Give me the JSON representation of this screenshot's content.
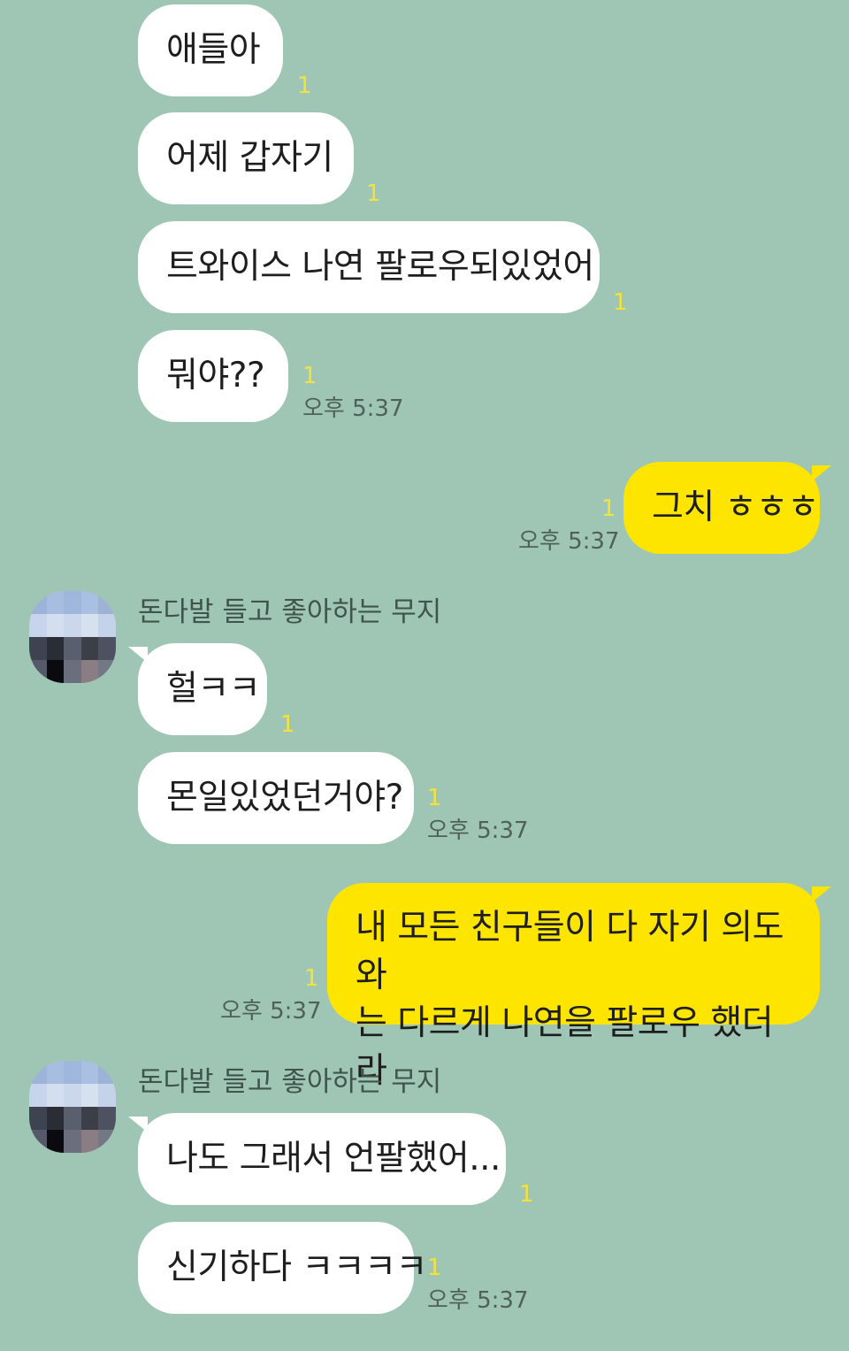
{
  "chat": {
    "sender_name": "돈다발 들고 좋아하는 무지",
    "unread_mark": "1",
    "messages": [
      {
        "text": "애들아"
      },
      {
        "text": "어제 갑자기"
      },
      {
        "text": "트와이스 나연 팔로우되있었어"
      },
      {
        "text": "뭐야??",
        "time": "오후 5:37"
      },
      {
        "text": "그치 ㅎㅎㅎ",
        "time": "오후 5:37"
      },
      {
        "text": "헐ㅋㅋ"
      },
      {
        "text": "몬일있었던거야?",
        "time": "오후 5:37"
      },
      {
        "line1": "내 모든 친구들이 다 자기 의도와",
        "line2": "는 다르게 나연을 팔로우 했더라",
        "time": "오후 5:37"
      },
      {
        "text": "나도 그래서 언팔했어..."
      },
      {
        "text": "신기하다 ㅋㅋㅋㅋ",
        "time": "오후 5:37"
      }
    ]
  },
  "colors": {
    "background": "#9fc6b4",
    "incoming_bubble": "#ffffff",
    "outgoing_bubble": "#fee500",
    "unread_count": "#f4e23c"
  },
  "icons": {
    "avatar": "pixelated-avatar"
  }
}
